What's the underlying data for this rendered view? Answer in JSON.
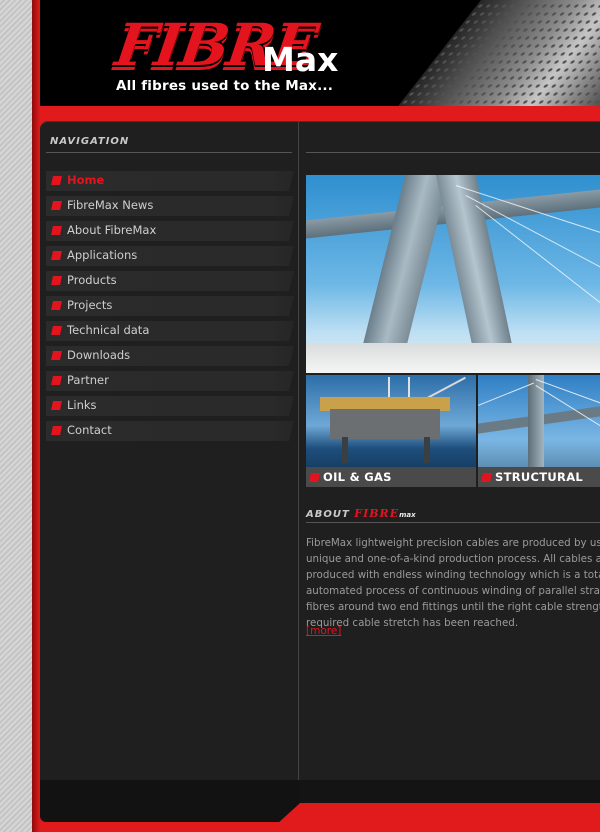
{
  "brand": {
    "logo_text_fibre": "FIBRE",
    "logo_text_max": "Max",
    "tagline": "All fibres used to the Max...",
    "accent_color": "#e3141e"
  },
  "navigation": {
    "title": "NAVIGATION",
    "items": [
      {
        "label": "Home",
        "active": true
      },
      {
        "label": "FibreMax News",
        "active": false
      },
      {
        "label": "About FibreMax",
        "active": false
      },
      {
        "label": "Applications",
        "active": false
      },
      {
        "label": "Products",
        "active": false
      },
      {
        "label": "Projects",
        "active": false
      },
      {
        "label": "Technical data",
        "active": false
      },
      {
        "label": "Downloads",
        "active": false
      },
      {
        "label": "Partner",
        "active": false
      },
      {
        "label": "Links",
        "active": false
      },
      {
        "label": "Contact",
        "active": false
      }
    ]
  },
  "tiles": [
    {
      "label": "OIL & GAS"
    },
    {
      "label": "STRUCTURAL"
    }
  ],
  "about": {
    "heading_prefix": "ABOUT",
    "heading_fibre": "FIBRE",
    "heading_max": "max",
    "lines": [
      "FibreMax lightweight precision cables are produced by usin",
      "unique and one-of-a-kind production process. All cables ar",
      "produced with endless winding technology which is a totall",
      "automated process of continuous winding of parallel strand",
      "fibres around two end fittings until the right cable strength",
      "required cable stretch has been reached."
    ],
    "more_label": "[more]"
  }
}
